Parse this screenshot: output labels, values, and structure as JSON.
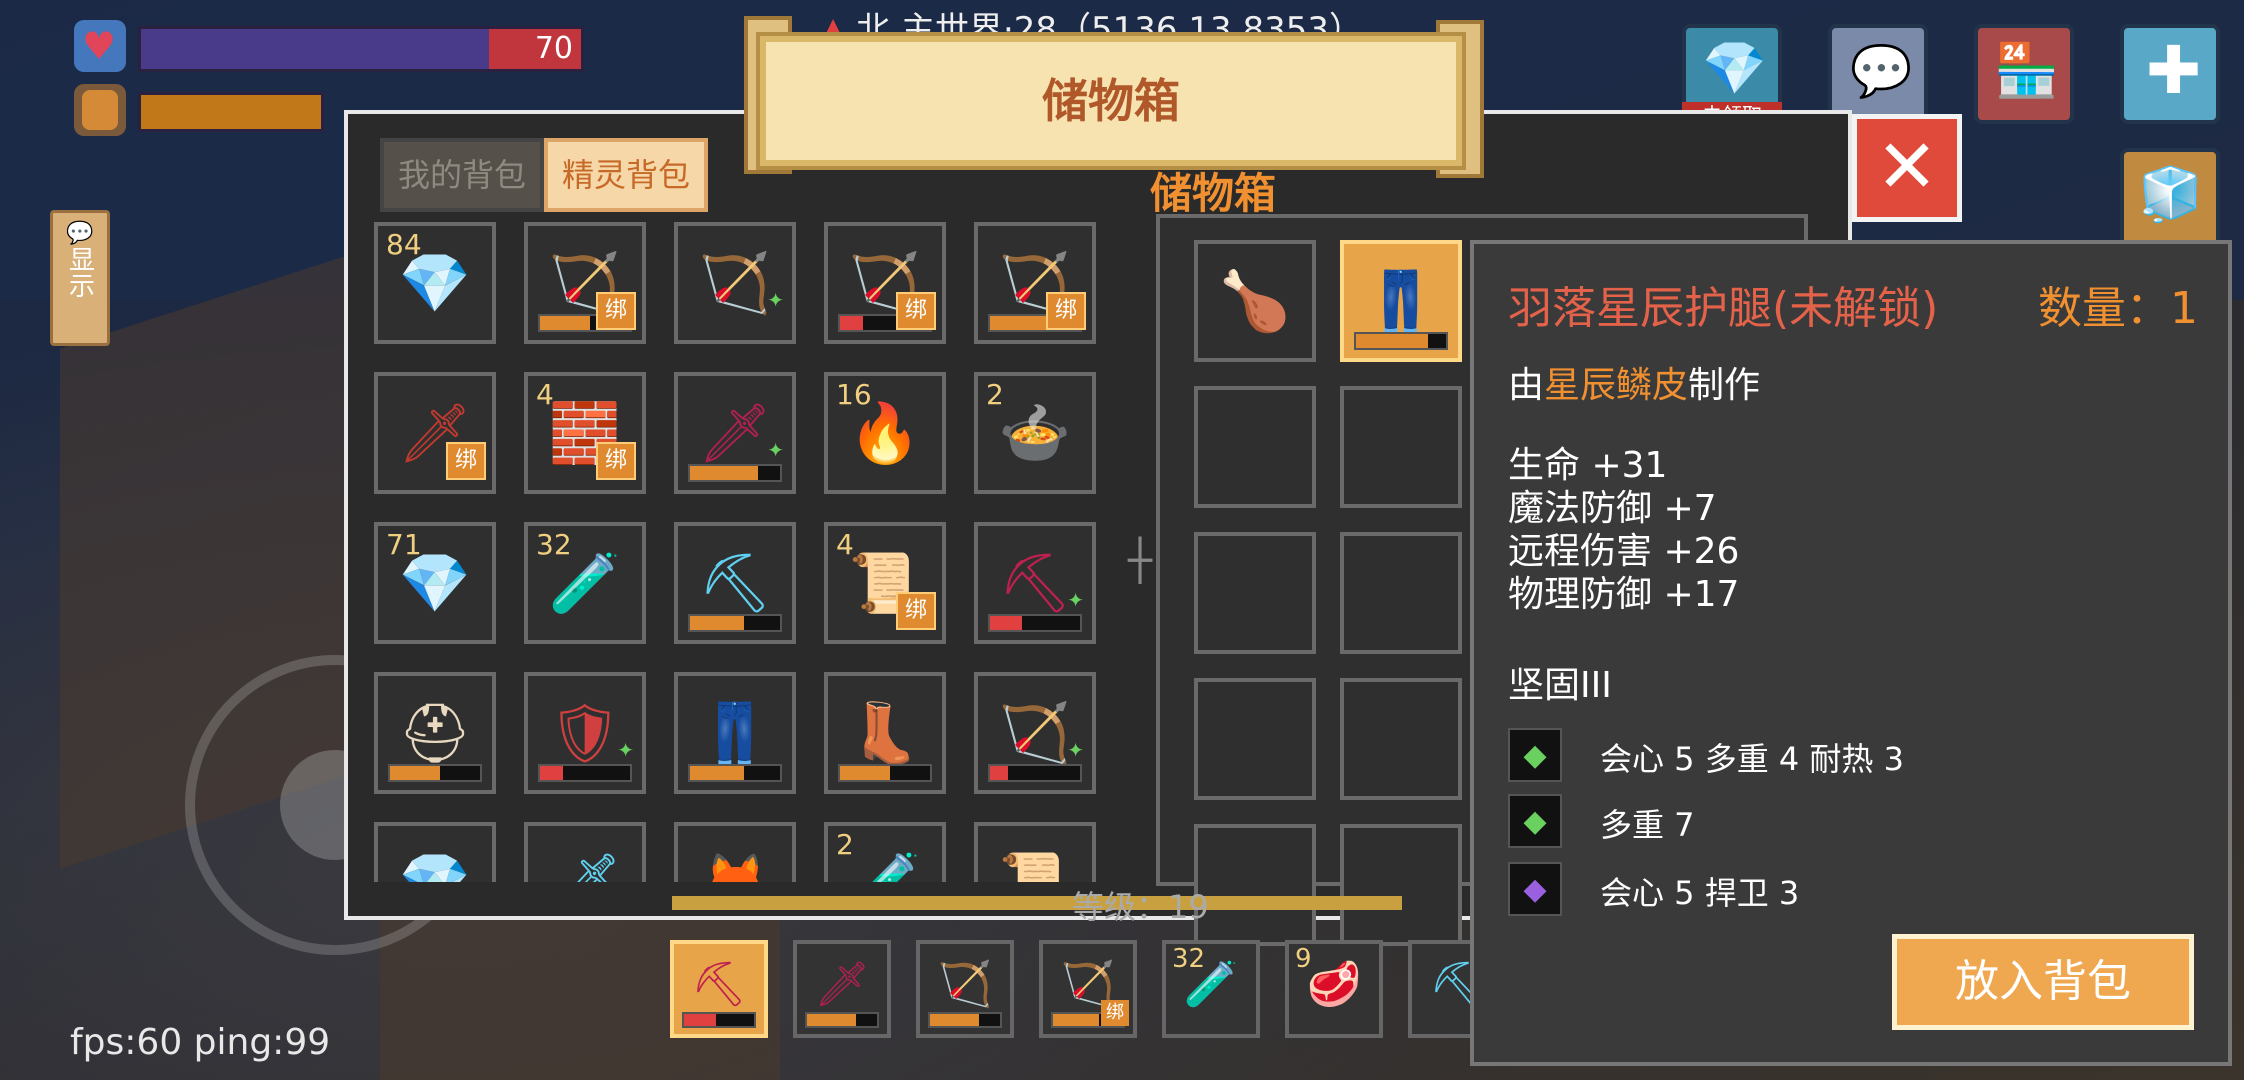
{
  "hud": {
    "hp_value": "70",
    "hp_fraction": 0.21,
    "coords": "北  主世界·28（5136,13,8353）",
    "side_button": "显示",
    "reward_badge": "未领取",
    "fps": "fps:60 ping:99"
  },
  "window": {
    "title": "储物箱",
    "tabs": [
      "我的背包",
      "精灵背包"
    ],
    "chest_label": "储物箱",
    "level_text": "等级：19",
    "close_glyph": "✕"
  },
  "backpack": [
    {
      "glyph": "💎",
      "color": "#f070d0",
      "count": "84"
    },
    {
      "glyph": "🏹",
      "color": "#70d0f0",
      "bind": "绑",
      "dur": 0.55,
      "durColor": "#e08a30"
    },
    {
      "glyph": "🏹",
      "color": "#70d0f0",
      "spark": true
    },
    {
      "glyph": "🏹",
      "color": "#f0c060",
      "bind": "绑",
      "dur": 0.25,
      "durColor": "#e04040"
    },
    {
      "glyph": "🏹",
      "color": "#c03050",
      "bind": "绑",
      "dur": 0.65,
      "durColor": "#e08a30"
    },
    {
      "glyph": "🗡",
      "color": "#c03a30",
      "bind": "绑"
    },
    {
      "glyph": "🧱",
      "color": "#e06050",
      "count": "4",
      "bind": "绑"
    },
    {
      "glyph": "🗡",
      "color": "#b02050",
      "dur": 0.75,
      "durColor": "#e08a30",
      "spark": true
    },
    {
      "glyph": "🔥",
      "color": "#f0a030",
      "count": "16"
    },
    {
      "glyph": "🍲",
      "color": "#f08060",
      "count": "2"
    },
    {
      "glyph": "💎",
      "color": "#60d0f0",
      "count": "71"
    },
    {
      "glyph": "🧪",
      "color": "#e04040",
      "count": "32"
    },
    {
      "glyph": "⛏",
      "color": "#60d0f0",
      "dur": 0.6,
      "durColor": "#e08a30"
    },
    {
      "glyph": "📜",
      "color": "#d09030",
      "count": "4",
      "bind": "绑"
    },
    {
      "glyph": "⛏",
      "color": "#c02050",
      "dur": 0.35,
      "durColor": "#e04040",
      "spark": true
    },
    {
      "glyph": "⛑",
      "color": "#e8d8c0",
      "dur": 0.55,
      "durColor": "#e08a30"
    },
    {
      "glyph": "🛡",
      "color": "#d04040",
      "dur": 0.25,
      "durColor": "#e04040",
      "spark": true
    },
    {
      "glyph": "👖",
      "color": "#e8d8c0",
      "dur": 0.6,
      "durColor": "#e08a30"
    },
    {
      "glyph": "👢",
      "color": "#e8d8c0",
      "dur": 0.55,
      "durColor": "#e08a30"
    },
    {
      "glyph": "🏹",
      "color": "#e04040",
      "dur": 0.2,
      "durColor": "#e04040",
      "spark": true
    },
    {
      "glyph": "💎",
      "color": "#60d0f0",
      "spark": true
    },
    {
      "glyph": "🗡",
      "color": "#60d0f0",
      "spark": true
    },
    {
      "glyph": "🦊",
      "color": "#e09030",
      "spark": true
    },
    {
      "glyph": "🧪",
      "color": "#f06040",
      "count": "2"
    },
    {
      "glyph": "📜",
      "color": "#e8d8c0"
    }
  ],
  "chest": [
    {
      "glyph": "🍗",
      "color": "#f0b0a0"
    },
    {
      "glyph": "👖",
      "color": "#7050c0",
      "selected": true,
      "dur": 0.8,
      "durColor": "#e08a30"
    }
  ],
  "hotbar": [
    {
      "glyph": "⛏",
      "color": "#c02050",
      "selected": true,
      "dur": 0.45,
      "durColor": "#e04040"
    },
    {
      "glyph": "🗡",
      "color": "#b02050",
      "dur": 0.7,
      "durColor": "#e08a30"
    },
    {
      "glyph": "🏹",
      "color": "#70d0f0",
      "dur": 0.7,
      "durColor": "#e08a30"
    },
    {
      "glyph": "🏹",
      "color": "#c03050",
      "bind": "绑",
      "dur": 0.65,
      "durColor": "#e08a30"
    },
    {
      "glyph": "🧪",
      "color": "#e04040",
      "count": "32"
    },
    {
      "glyph": "🥩",
      "color": "#a04830",
      "count": "9"
    },
    {
      "glyph": "⛏",
      "color": "#60d0f0"
    }
  ],
  "tooltip": {
    "name": "羽落星辰护腿(未解锁)",
    "count": "数量：1",
    "made_prefix": "由",
    "made_material": "星辰鳞皮",
    "made_suffix": "制作",
    "stats": [
      "生命 +31",
      "魔法防御 +7",
      "远程伤害 +26",
      "物理防御 +17"
    ],
    "enchant": "坚固III",
    "gems": [
      {
        "color": "#6ad060",
        "text": "会心 5    多重 4    耐热 3"
      },
      {
        "color": "#6ad060",
        "text": "多重 7"
      },
      {
        "color": "#9a60e0",
        "text": "会心 5    捍卫 3"
      }
    ],
    "button": "放入背包"
  }
}
